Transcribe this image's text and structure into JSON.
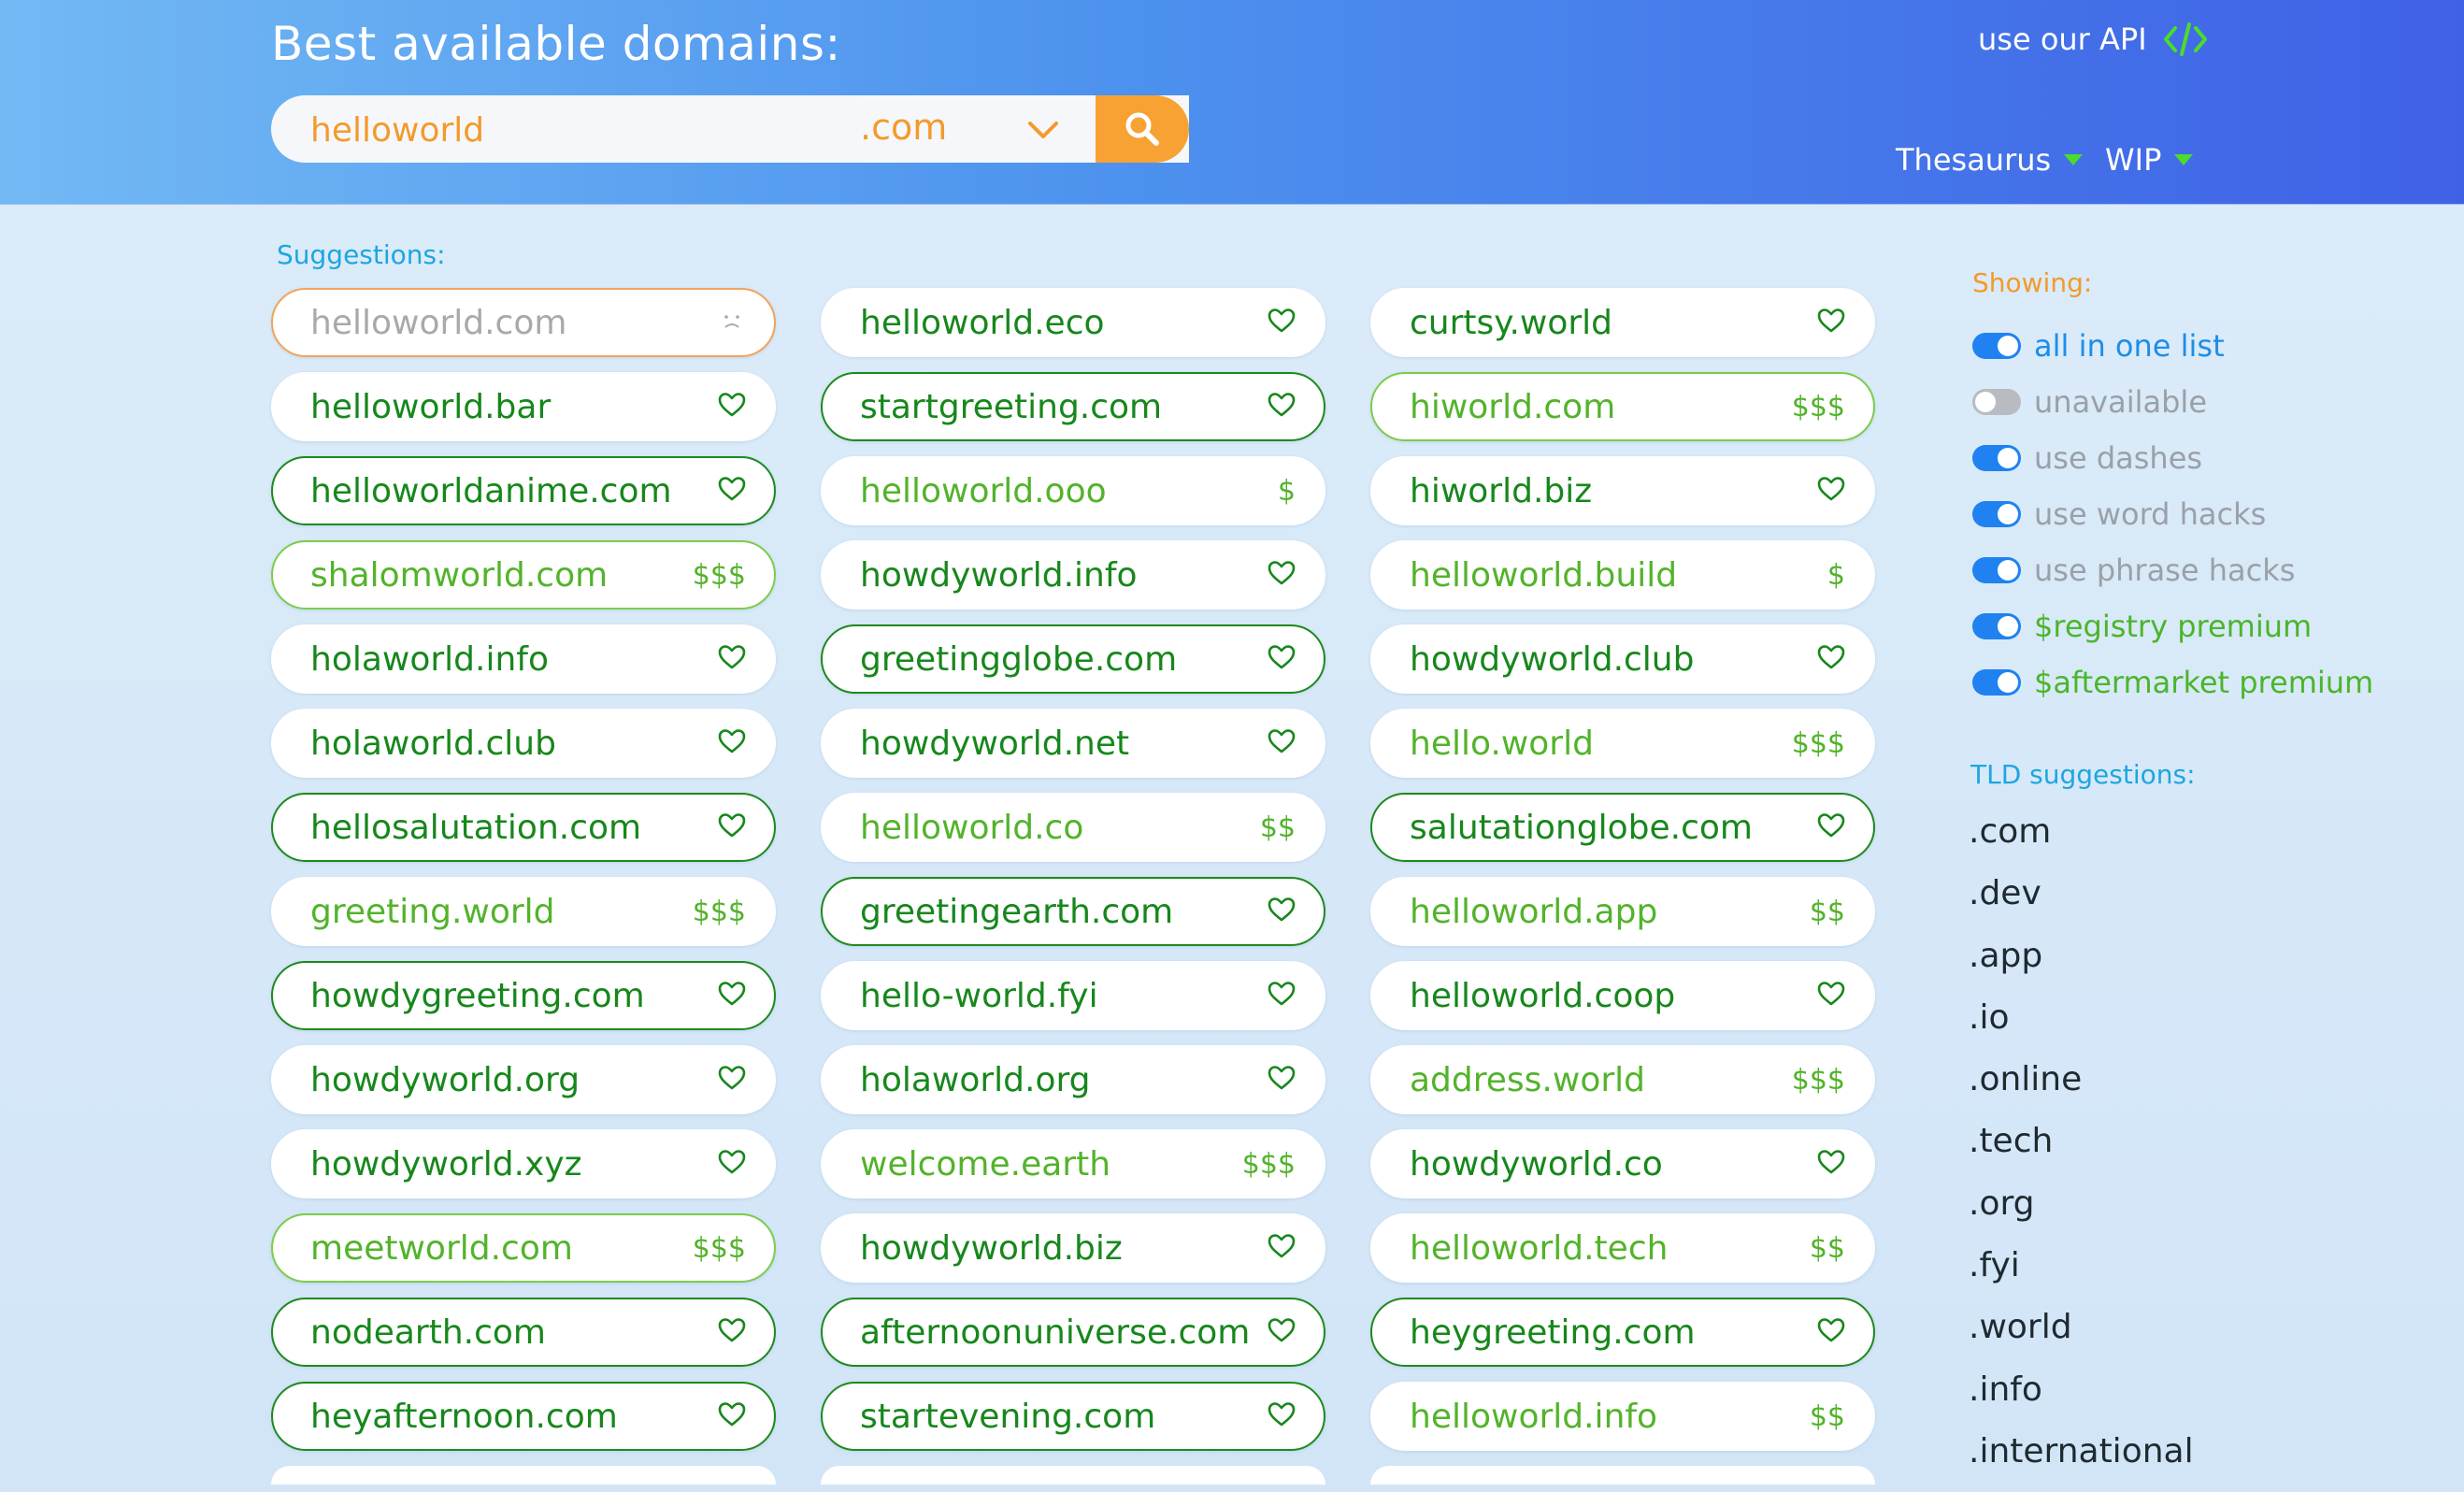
{
  "header": {
    "title": "Best available domains:",
    "search_value": "helloworld",
    "tld_value": ".com",
    "api_link": "use our API",
    "menus": [
      "Thesaurus",
      "WIP"
    ]
  },
  "colors": {
    "available_dark": "#17871c",
    "available_light": "#53b32b",
    "taken": "#a9a9a9",
    "accent_orange": "#f7a233",
    "toggle_on": "#1f82f0"
  },
  "suggestions_label": "Suggestions:",
  "results": [
    {
      "name": "helloworld.com",
      "tag": "",
      "status": "taken"
    },
    {
      "name": "helloworld.eco",
      "tag": "",
      "status": "plain"
    },
    {
      "name": "curtsy.world",
      "tag": "",
      "status": "plain"
    },
    {
      "name": "helloworld.bar",
      "tag": "",
      "status": "plain"
    },
    {
      "name": "startgreeting.com",
      "tag": "",
      "status": "outlined"
    },
    {
      "name": "hiworld.com",
      "tag": "$$$",
      "status": "outlined-light"
    },
    {
      "name": "helloworldanime.com",
      "tag": "",
      "status": "outlined"
    },
    {
      "name": "helloworld.ooo",
      "tag": "$",
      "status": "light"
    },
    {
      "name": "hiworld.biz",
      "tag": "",
      "status": "plain"
    },
    {
      "name": "shalomworld.com",
      "tag": "$$$",
      "status": "outlined-light"
    },
    {
      "name": "howdyworld.info",
      "tag": "",
      "status": "plain"
    },
    {
      "name": "helloworld.build",
      "tag": "$",
      "status": "light"
    },
    {
      "name": "holaworld.info",
      "tag": "",
      "status": "plain"
    },
    {
      "name": "greetingglobe.com",
      "tag": "",
      "status": "outlined"
    },
    {
      "name": "howdyworld.club",
      "tag": "",
      "status": "plain"
    },
    {
      "name": "holaworld.club",
      "tag": "",
      "status": "plain"
    },
    {
      "name": "howdyworld.net",
      "tag": "",
      "status": "plain"
    },
    {
      "name": "hello.world",
      "tag": "$$$",
      "status": "light"
    },
    {
      "name": "hellosalutation.com",
      "tag": "",
      "status": "outlined"
    },
    {
      "name": "helloworld.co",
      "tag": "$$",
      "status": "light"
    },
    {
      "name": "salutationglobe.com",
      "tag": "",
      "status": "outlined"
    },
    {
      "name": "greeting.world",
      "tag": "$$$",
      "status": "light"
    },
    {
      "name": "greetingearth.com",
      "tag": "",
      "status": "outlined"
    },
    {
      "name": "helloworld.app",
      "tag": "$$",
      "status": "light"
    },
    {
      "name": "howdygreeting.com",
      "tag": "",
      "status": "outlined"
    },
    {
      "name": "hello-world.fyi",
      "tag": "",
      "status": "plain"
    },
    {
      "name": "helloworld.coop",
      "tag": "",
      "status": "plain"
    },
    {
      "name": "howdyworld.org",
      "tag": "",
      "status": "plain"
    },
    {
      "name": "holaworld.org",
      "tag": "",
      "status": "plain"
    },
    {
      "name": "address.world",
      "tag": "$$$",
      "status": "light"
    },
    {
      "name": "howdyworld.xyz",
      "tag": "",
      "status": "plain"
    },
    {
      "name": "welcome.earth",
      "tag": "$$$",
      "status": "light"
    },
    {
      "name": "howdyworld.co",
      "tag": "",
      "status": "plain"
    },
    {
      "name": "meetworld.com",
      "tag": "$$$",
      "status": "outlined-light"
    },
    {
      "name": "howdyworld.biz",
      "tag": "",
      "status": "plain"
    },
    {
      "name": "helloworld.tech",
      "tag": "$$",
      "status": "light"
    },
    {
      "name": "nodearth.com",
      "tag": "",
      "status": "outlined"
    },
    {
      "name": "afternoonuniverse.com",
      "tag": "",
      "status": "outlined"
    },
    {
      "name": "heygreeting.com",
      "tag": "",
      "status": "outlined"
    },
    {
      "name": "heyafternoon.com",
      "tag": "",
      "status": "outlined"
    },
    {
      "name": "startevening.com",
      "tag": "",
      "status": "outlined"
    },
    {
      "name": "helloworld.info",
      "tag": "$$",
      "status": "light"
    }
  ],
  "sidebar": {
    "showing_label": "Showing:",
    "toggles": [
      {
        "label": "all in one list",
        "on": true,
        "style": "blue"
      },
      {
        "label": "unavailable",
        "on": false,
        "style": "gray"
      },
      {
        "label": "use dashes",
        "on": true,
        "style": "gray"
      },
      {
        "label": "use word hacks",
        "on": true,
        "style": "gray"
      },
      {
        "label": "use phrase hacks",
        "on": true,
        "style": "gray"
      },
      {
        "label": "$registry premium",
        "on": true,
        "style": "green"
      },
      {
        "label": "$aftermarket premium",
        "on": true,
        "style": "green"
      }
    ],
    "tld_label": "TLD suggestions:",
    "tlds": [
      ".com",
      ".dev",
      ".app",
      ".io",
      ".online",
      ".tech",
      ".org",
      ".fyi",
      ".world",
      ".info",
      ".international"
    ]
  }
}
